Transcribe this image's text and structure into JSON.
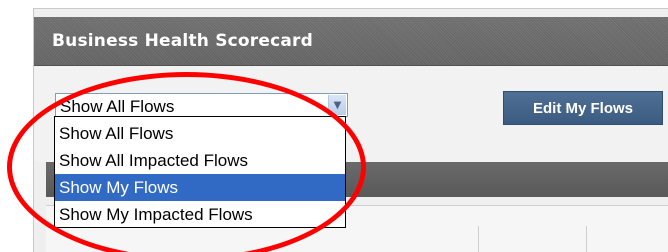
{
  "panel": {
    "title": "Business Health Scorecard"
  },
  "toolbar": {
    "selected_option": "Show All Flows",
    "edit_button_label": "Edit My Flows"
  },
  "dropdown": {
    "options": [
      {
        "label": "Show All Flows",
        "selected": false
      },
      {
        "label": "Show All Impacted Flows",
        "selected": false
      },
      {
        "label": "Show My Flows",
        "selected": true
      },
      {
        "label": "Show My Impacted Flows",
        "selected": false
      }
    ]
  },
  "icons": {
    "select_arrow": "chevron-down-icon"
  },
  "colors": {
    "header_bg": "#6b6b6b",
    "button_bg": "#45658a",
    "selection_bg": "#316ac5",
    "annotation": "#ff0000"
  }
}
